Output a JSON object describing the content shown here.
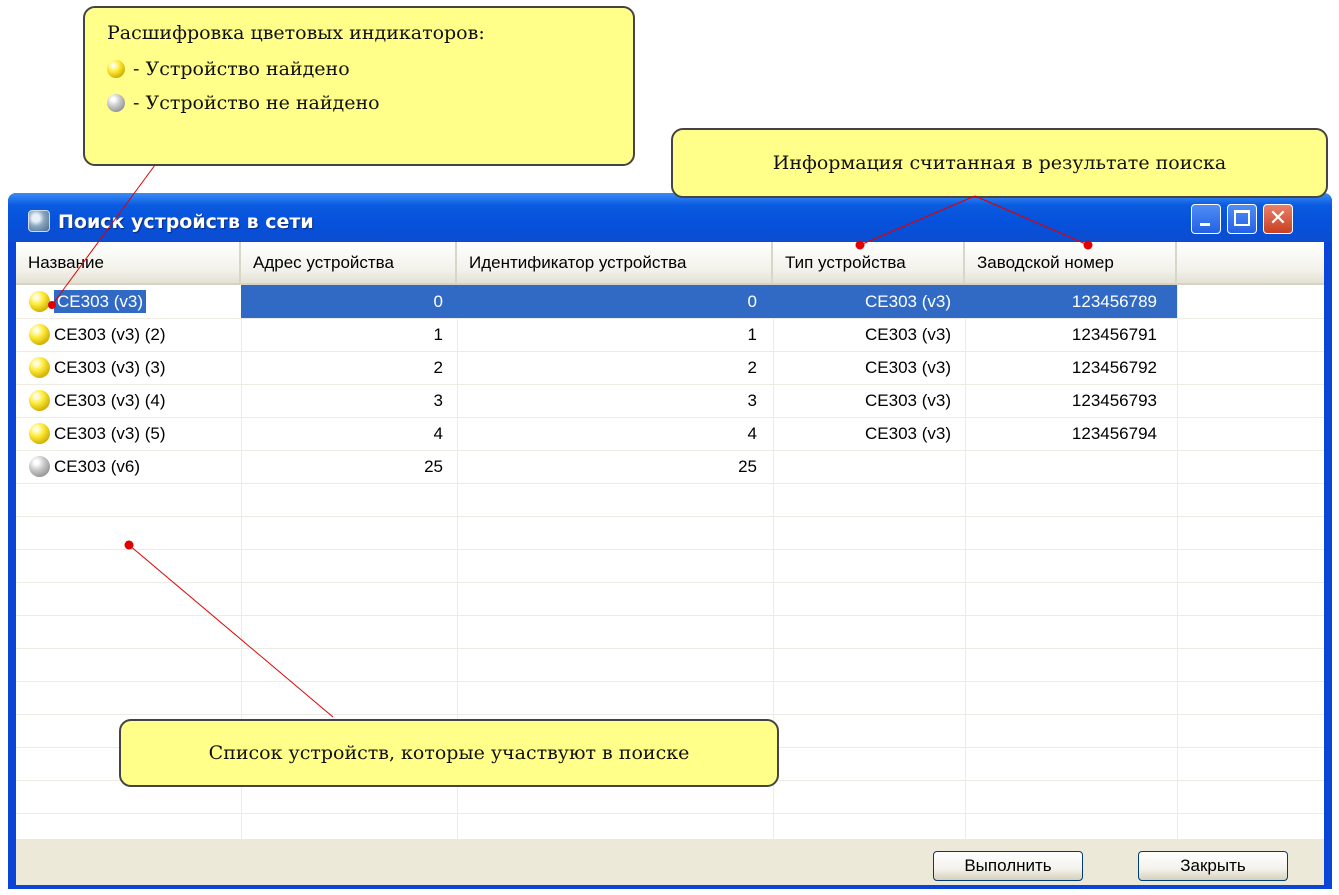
{
  "window": {
    "title": "Поиск устройств в сети",
    "minimize_icon": "minimize-icon",
    "maximize_icon": "maximize-icon",
    "close_icon": "close-icon",
    "close_glyph": "✕"
  },
  "table": {
    "columns": [
      "Название",
      "Адрес устройства",
      "Идентификатор устройства",
      "Тип устройства",
      "Заводской номер"
    ],
    "rows": [
      {
        "indicator": "yellow",
        "name": "CE303 (v3)",
        "address": "0",
        "identifier": "0",
        "type": "CE303 (v3)",
        "serial": "123456789",
        "selected": true
      },
      {
        "indicator": "yellow",
        "name": "CE303 (v3) (2)",
        "address": "1",
        "identifier": "1",
        "type": "CE303 (v3)",
        "serial": "123456791",
        "selected": false
      },
      {
        "indicator": "yellow",
        "name": "CE303 (v3) (3)",
        "address": "2",
        "identifier": "2",
        "type": "CE303 (v3)",
        "serial": "123456792",
        "selected": false
      },
      {
        "indicator": "yellow",
        "name": "CE303 (v3) (4)",
        "address": "3",
        "identifier": "3",
        "type": "CE303 (v3)",
        "serial": "123456793",
        "selected": false
      },
      {
        "indicator": "yellow",
        "name": "CE303 (v3) (5)",
        "address": "4",
        "identifier": "4",
        "type": "CE303 (v3)",
        "serial": "123456794",
        "selected": false
      },
      {
        "indicator": "gray",
        "name": "CE303 (v6)",
        "address": "25",
        "identifier": "25",
        "type": "",
        "serial": "",
        "selected": false
      }
    ]
  },
  "buttons": {
    "run": "Выполнить",
    "close": "Закрыть"
  },
  "callouts": {
    "legend_title": "Расшифровка цветовых индикаторов:",
    "legend_found": "- Устройство найдено",
    "legend_not_found": "- Устройство не найдено",
    "info": "Информация считанная в результате поиска",
    "list": "Список устройств, которые участвуют в поиске"
  },
  "colors": {
    "indicator_found": "#ffec3a",
    "indicator_not_found": "#a0a0a0",
    "selection": "#316ac5",
    "callout_bg": "#ffff8a",
    "pointer_line": "#e00000"
  }
}
